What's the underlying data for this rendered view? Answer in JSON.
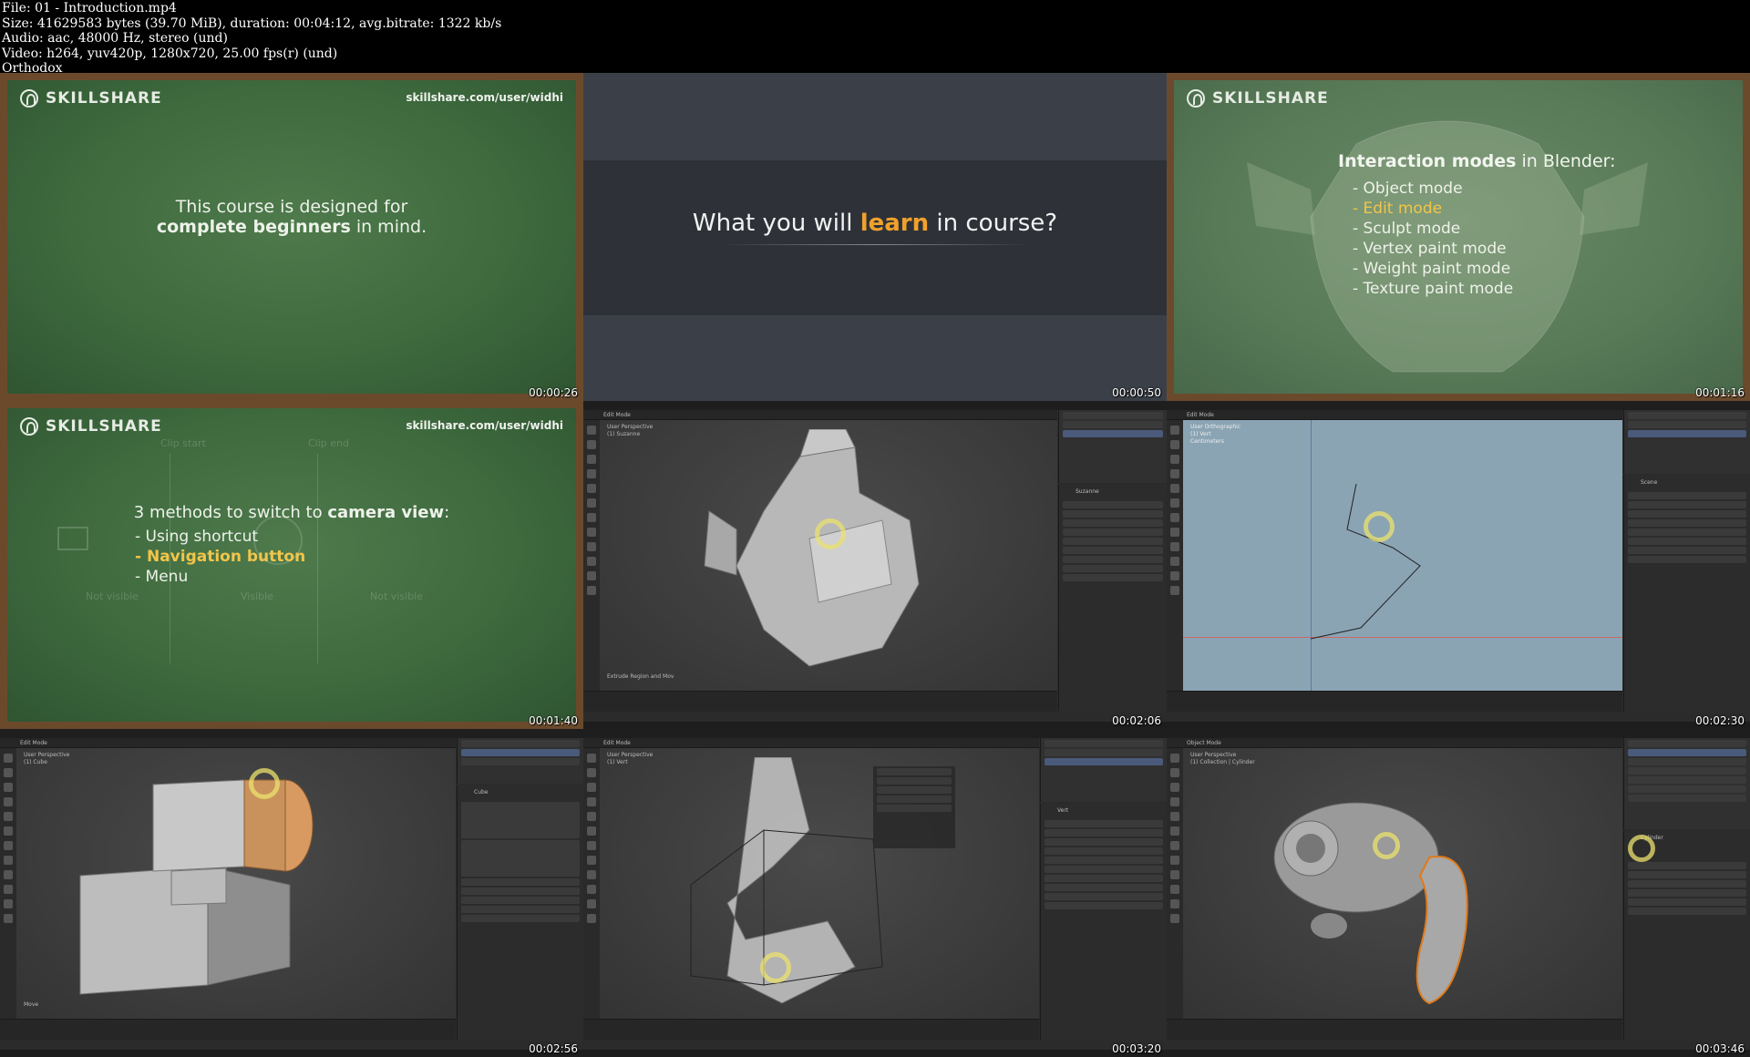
{
  "header": {
    "file": "File: 01 - Introduction.mp4",
    "size": "Size: 41629583 bytes (39.70 MiB), duration: 00:04:12, avg.bitrate: 1322 kb/s",
    "audio": "Audio: aac, 48000 Hz, stereo (und)",
    "video": "Video: h264, yuv420p, 1280x720, 25.00 fps(r) (und)",
    "tag": "Orthodox"
  },
  "brand": {
    "logo_text": "SKILLSHARE",
    "url": "skillshare.com/user/widhi"
  },
  "tiles": [
    {
      "timestamp": "00:00:26",
      "line1": "This course is designed for",
      "line2_bold": "complete beginners",
      "line2_rest": " in mind."
    },
    {
      "timestamp": "00:00:50",
      "text_a": "What you will ",
      "text_b": "learn",
      "text_c": " in course?"
    },
    {
      "timestamp": "00:01:16",
      "heading_bold": "Interaction modes",
      "heading_rest": " in Blender:",
      "modes": [
        "Object mode",
        "Edit mode",
        "Sculpt mode",
        "Vertex paint mode",
        "Weight paint mode",
        "Texture paint mode"
      ]
    },
    {
      "timestamp": "00:01:40",
      "heading_a": "3 methods to switch to ",
      "heading_b": "camera view",
      "heading_c": ":",
      "items": [
        "Using shortcut",
        "Navigation button",
        "Menu"
      ],
      "ghost": {
        "clip_start": "Clip start",
        "clip_end": "Clip end",
        "not_visible_1": "Not visible",
        "visible": "Visible",
        "not_visible_2": "Not visible"
      }
    },
    {
      "timestamp": "00:02:06",
      "mode": "Edit Mode",
      "view": "User Perspective",
      "object": "(1) Suzanne",
      "panel_name": "Suzanne",
      "op": "Extrude Region and Mov"
    },
    {
      "timestamp": "00:02:30",
      "mode": "Edit Mode",
      "view": "User Orthographic",
      "object": "(1) Vert",
      "unit": "Centimeters",
      "panel_name": "Scene"
    },
    {
      "timestamp": "00:02:56",
      "mode": "Edit Mode",
      "view": "User Perspective",
      "object": "(1) Cube",
      "panel_name": "Cube",
      "op": "Move"
    },
    {
      "timestamp": "00:03:20",
      "mode": "Edit Mode",
      "view": "User Perspective",
      "object": "(1) Vert",
      "panel_name": "Vert"
    },
    {
      "timestamp": "00:03:46",
      "mode": "Object Mode",
      "view": "User Perspective",
      "object": "(1) Collection | Cylinder",
      "panel_name": "Cylinder"
    }
  ]
}
